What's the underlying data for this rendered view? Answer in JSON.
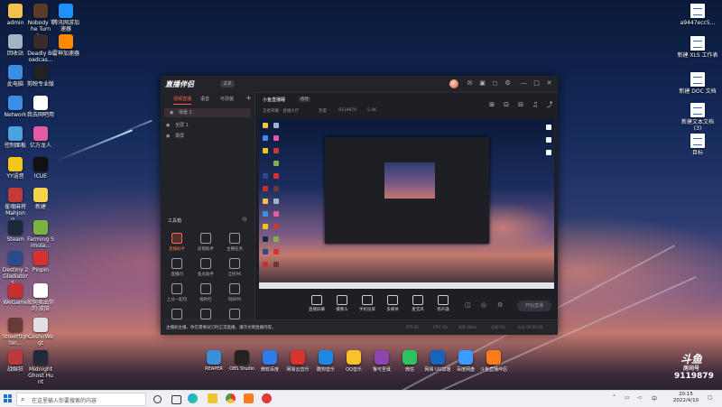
{
  "desktop": {
    "left_icons": [
      {
        "label": "admin",
        "color": "#f2c14e"
      },
      {
        "label": "Nobody The Turna...",
        "color": "#5b3a2a"
      },
      {
        "label": "腾讯网游加速器",
        "color": "#1e90ff"
      },
      {
        "label": "回收站",
        "color": "#9fb5c8"
      },
      {
        "label": "Deadly Broadcas...",
        "color": "#3b2a2a"
      },
      {
        "label": "雷神加速器",
        "color": "#ff8a00"
      },
      {
        "label": "此电脑",
        "color": "#3a8ee6"
      },
      {
        "label": "剪映专业版",
        "color": "#222"
      },
      {
        "label": "Network",
        "color": "#3a8ee6"
      },
      {
        "label": "我去网吧用",
        "color": "#fff"
      },
      {
        "label": "控制面板",
        "color": "#4aa3df"
      },
      {
        "label": "亿万龙人",
        "color": "#e35ba3"
      },
      {
        "label": "YY语音",
        "color": "#f5c518"
      },
      {
        "label": "ICUE",
        "color": "#111"
      },
      {
        "label": "雀魂麻将 Mahjong...",
        "color": "#c23b3b"
      },
      {
        "label": "新建",
        "color": "#f3d24a"
      },
      {
        "label": "Steam",
        "color": "#1b2838"
      },
      {
        "label": "Farming Simula...",
        "color": "#7cb342"
      },
      {
        "label": "Destiny 2 Gladiators...",
        "color": "#2b4a8a"
      },
      {
        "label": "Pinpin",
        "color": "#d93030"
      },
      {
        "label": "WeGame",
        "color": "#c72e2e"
      },
      {
        "label": "如何卖出你的 皮肤",
        "color": "#fff"
      },
      {
        "label": "Streetfighter...",
        "color": "#6a3a3a"
      },
      {
        "label": "Ceshi/Wegt",
        "color": "#e0e0e0"
      },
      {
        "label": "战娱狂",
        "color": "#b83a3a"
      },
      {
        "label": "Midnight Ghost Hunt",
        "color": "#1f2a3a"
      }
    ],
    "right_icons": [
      {
        "label": "a9447ecc5...",
        "color": "#fff"
      },
      {
        "label": "新建 XLS 工作表",
        "color": "#fff"
      },
      {
        "label": "新建 DOC 文档",
        "color": "#fff"
      },
      {
        "label": "新建文本文档 (3)",
        "color": "#fff"
      },
      {
        "label": "目标",
        "color": "#fff"
      }
    ],
    "dock": [
      {
        "label": "REAPER",
        "color": "#3a8fd8"
      },
      {
        "label": "OBS Studio",
        "color": "#222"
      },
      {
        "label": "微软百度",
        "color": "#2b7de9"
      },
      {
        "label": "网易云音乐",
        "color": "#d9342b"
      },
      {
        "label": "酷狗音乐",
        "color": "#1e88e5"
      },
      {
        "label": "QQ音乐",
        "color": "#fbc02d"
      },
      {
        "label": "鲁可圣诞",
        "color": "#8e44ad"
      },
      {
        "label": "微信",
        "color": "#2ec25e"
      },
      {
        "label": "网易 UU加速",
        "color": "#1565c0"
      },
      {
        "label": "百度网盘",
        "color": "#3b9cff"
      },
      {
        "label": "斗鱼直播伴侣",
        "color": "#ff7a1a"
      }
    ]
  },
  "obs_window": {
    "app_name": "直播伴侣",
    "version": "2.0",
    "window_controls": [
      "—",
      "□",
      "✕"
    ],
    "tabs": [
      "视频直播",
      "语音",
      "可改装"
    ],
    "scenes": [
      {
        "label": "场景 1",
        "selected": true
      },
      {
        "label": "全屏 1",
        "selected": false
      },
      {
        "label": "录屏",
        "selected": false
      }
    ],
    "tools_title": "工具箱",
    "tools": [
      {
        "label": "直播助手",
        "hot": true
      },
      {
        "label": "房管助手",
        "hot": false
      },
      {
        "label": "主播任务",
        "hot": false
      },
      {
        "label": "直播间",
        "hot": false
      },
      {
        "label": "鱼丸助手",
        "hot": false
      },
      {
        "label": "全民PK",
        "hot": false
      },
      {
        "label": "上分一起玩",
        "hot": false
      },
      {
        "label": "福利社",
        "hot": false
      },
      {
        "label": "同屏PK",
        "hot": false
      },
      {
        "label": "更多",
        "hot": false
      },
      {
        "label": "弹幕",
        "hot": false
      },
      {
        "label": "直播",
        "hot": false
      }
    ],
    "room": {
      "title": "小鱼直播睡",
      "badge": "修改",
      "category": "王者荣耀 · 直播大厅",
      "hot_label": "热度",
      "room_id": "9119879",
      "fans": "5.4K"
    },
    "bottom_tools": [
      "直播屏幕",
      "摄像头",
      "手机投屏",
      "多媒体",
      "麦克风",
      "扬声器"
    ],
    "start_button": "开始直播",
    "notice": "主播如主播，你在需要动刀时正常直播，遵守文明直播内容。",
    "status_items": [
      "FPS 60",
      "CPU 4%",
      "码率 0kb/s",
      "丢帧 0%",
      "时长 00:00:00"
    ]
  },
  "watermark": {
    "brand": "斗鱼",
    "room_label": "房间号",
    "room_number": "9119879"
  },
  "taskbar": {
    "search_placeholder": "在这里输入你要搜索的内容",
    "search_icon": "search-icon",
    "time": "20:15",
    "date": "2022/4/10",
    "tray_lang": "中"
  }
}
